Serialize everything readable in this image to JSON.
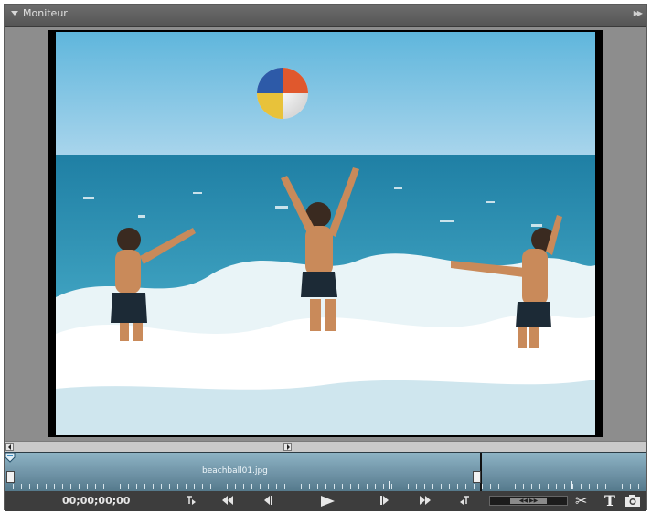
{
  "panel": {
    "title": "Moniteur",
    "collapse_icon": "collapse-triangle-icon",
    "menu_icon": "panel-menu-icon"
  },
  "video": {
    "content_description_icon": "video-frame"
  },
  "timeline": {
    "clip_name": "beachball01.jpg"
  },
  "controls": {
    "timecode": "00;00;00;00",
    "buttons": [
      {
        "name": "set-in-point",
        "glyph": "⇤"
      },
      {
        "name": "go-to-in-point",
        "glyph": "◀◀"
      },
      {
        "name": "step-back",
        "glyph": "◀|"
      },
      {
        "name": "play",
        "glyph": "▶"
      },
      {
        "name": "step-forward",
        "glyph": "|▶"
      },
      {
        "name": "go-to-out-point",
        "glyph": "▶▶"
      },
      {
        "name": "set-out-point",
        "glyph": "⇥"
      }
    ],
    "tools": [
      {
        "name": "split-clip",
        "glyph": "✂"
      },
      {
        "name": "add-text",
        "glyph": "T"
      },
      {
        "name": "freeze-frame",
        "glyph": "📷"
      }
    ]
  },
  "colors": {
    "panel_bg": "#8c8c8c",
    "timeline_blue": "#6f93a6",
    "controls_bg": "#3d3d3d"
  }
}
